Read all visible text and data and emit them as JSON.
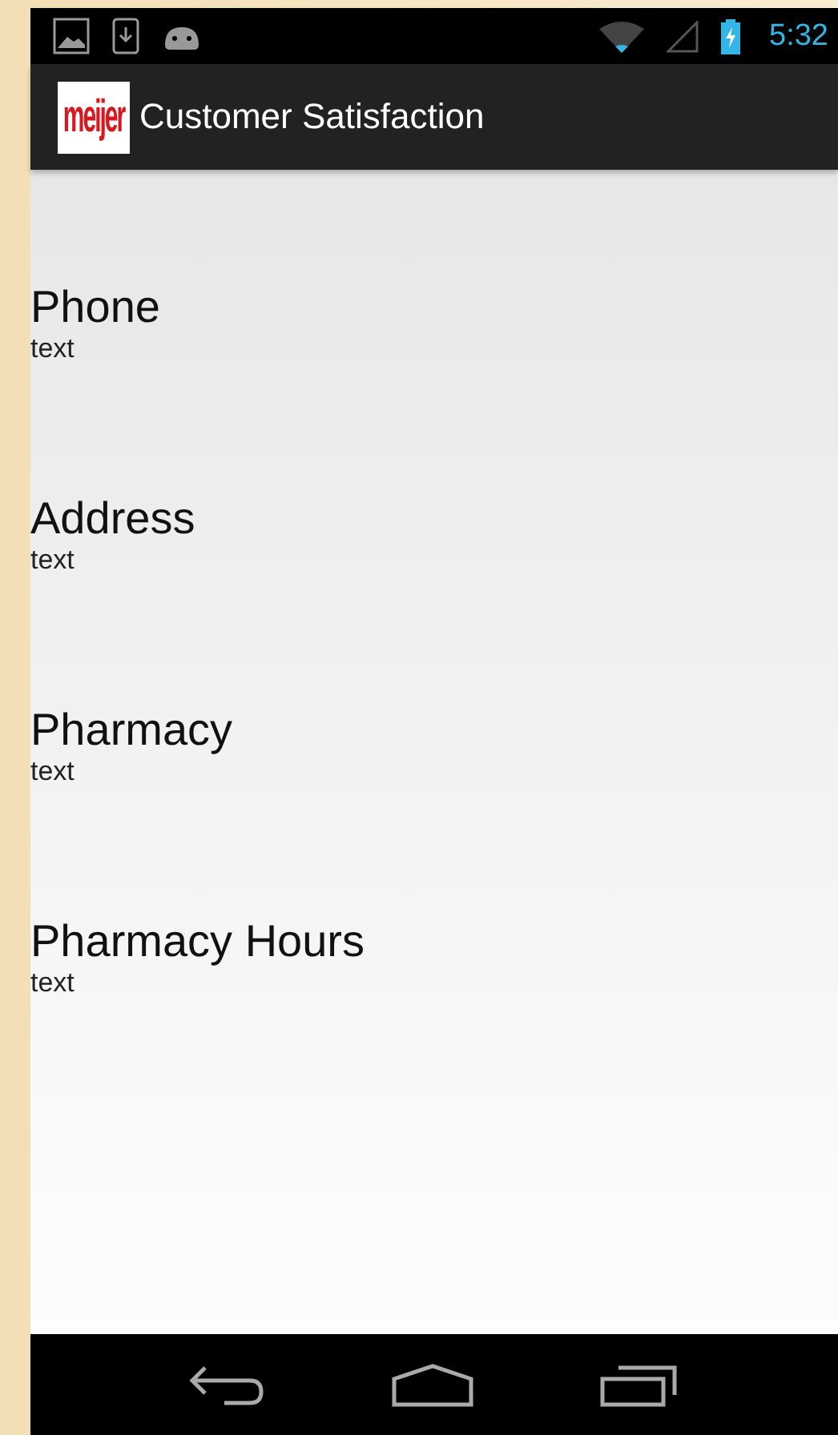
{
  "status_bar": {
    "time": "5:32"
  },
  "action_bar": {
    "logo": "meijer",
    "title": "Customer Satisfaction"
  },
  "sections": [
    {
      "title": "Phone",
      "value": "text"
    },
    {
      "title": "Address",
      "value": "text"
    },
    {
      "title": "Pharmacy",
      "value": "text"
    },
    {
      "title": "Pharmacy Hours",
      "value": "text"
    }
  ]
}
